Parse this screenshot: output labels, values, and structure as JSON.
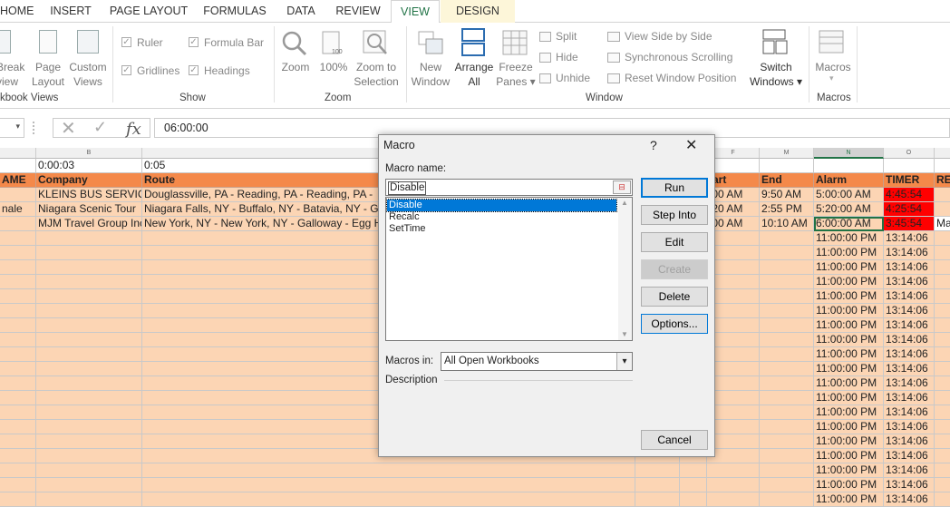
{
  "ribbon": {
    "tabs": [
      "HOME",
      "INSERT",
      "PAGE LAYOUT",
      "FORMULAS",
      "DATA",
      "REVIEW",
      "VIEW",
      "DESIGN"
    ],
    "workbook_views": {
      "break_preview": [
        "Break",
        "view"
      ],
      "page_layout": [
        "Page",
        "Layout"
      ],
      "custom_views": [
        "Custom",
        "Views"
      ],
      "group": "kbook Views"
    },
    "show": {
      "ruler": "Ruler",
      "formula_bar": "Formula Bar",
      "gridlines": "Gridlines",
      "headings": "Headings",
      "group": "Show"
    },
    "zoom": {
      "zoom": "Zoom",
      "zoom100": "100%",
      "zoom_sel": [
        "Zoom to",
        "Selection"
      ],
      "group": "Zoom"
    },
    "window": {
      "new_window": [
        "New",
        "Window"
      ],
      "arrange_all": [
        "Arrange",
        "All"
      ],
      "freeze_panes": [
        "Freeze",
        "Panes"
      ],
      "split": "Split",
      "hide": "Hide",
      "unhide": "Unhide",
      "side_by_side": "View Side by Side",
      "sync_scroll": "Synchronous Scrolling",
      "reset_pos": "Reset Window Position",
      "switch": [
        "Switch",
        "Windows"
      ],
      "group": "Window"
    },
    "macros": {
      "macros": "Macros",
      "group": "Macros"
    }
  },
  "formula": {
    "value": "06:00:00",
    "fx": "fx"
  },
  "columns": {
    "B": "B",
    "F": "F",
    "M": "M",
    "N": "N",
    "O": "O"
  },
  "sheet": {
    "row1": {
      "b": "0:00:03",
      "c": "0:05"
    },
    "headers": {
      "a": "AME",
      "company": "Company",
      "route": "Route",
      "start": "tart",
      "end": "End",
      "alarm": "Alarm",
      "timer": "TIMER",
      "re": "RE"
    },
    "rows": [
      {
        "a": "",
        "company": "KLEINS BUS SERVIC",
        "route": "Douglassville, PA - Reading, PA - Reading, PA -",
        "start": ":00 AM",
        "end": "9:50 AM",
        "alarm": "5:00:00 AM",
        "timer": "4:45:54",
        "extra": ""
      },
      {
        "a": "nale",
        "company": "Niagara Scenic Tour",
        "route": "Niagara Falls, NY - Buffalo, NY - Batavia, NY - G",
        "start": ":20 AM",
        "end": "2:55 PM",
        "alarm": "5:20:00 AM",
        "timer": "4:25:54",
        "extra": ""
      },
      {
        "a": "",
        "company": "MJM Travel Group Inc",
        "route": "New York, NY - New York, NY - Galloway - Egg H",
        "start": ":00 AM",
        "end": "10:10 AM",
        "alarm": "6:00:00 AM",
        "timer": "3:45:54",
        "extra": "Ma"
      }
    ],
    "filler": {
      "alarm": "11:00:00 PM",
      "timer": "13:14:06"
    }
  },
  "dialog": {
    "title": "Macro",
    "help": "?",
    "close": "✕",
    "name_label": "Macro name:",
    "name_value": "Disable",
    "macros": [
      "Disable",
      "Recalc",
      "SetTime"
    ],
    "selected": "Disable",
    "macros_in_label": "Macros in:",
    "macros_in_value": "All Open Workbooks",
    "description_label": "Description",
    "buttons": {
      "run": "Run",
      "step_into": "Step Into",
      "edit": "Edit",
      "create": "Create",
      "delete": "Delete",
      "options": "Options...",
      "cancel": "Cancel"
    }
  },
  "colors": {
    "header_orange": "#f4894a",
    "row_peach": "#fcd5b4",
    "timer_red": "#ff0000",
    "excel_green": "#217346",
    "select_blue": "#0078d7"
  }
}
